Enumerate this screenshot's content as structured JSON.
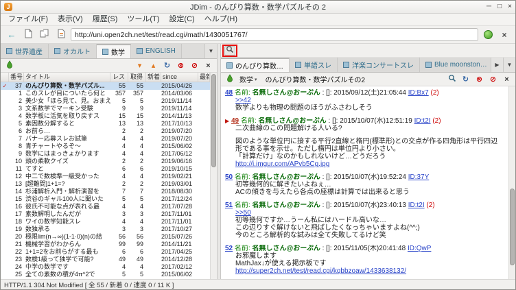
{
  "window": {
    "title": "JDim - のんびり算数・数学パズルその 2"
  },
  "menubar": {
    "items": [
      "ファイル(F)",
      "表示(V)",
      "履歴(S)",
      "ツール(T)",
      "設定(C)",
      "ヘルプ(H)"
    ]
  },
  "toolbar": {
    "url": "http://uni.open2ch.net/test/read.cgi/math/1430051767/"
  },
  "icons": {
    "back": "←",
    "window_minimize": "─",
    "window_maximize": "□",
    "window_close": "×",
    "tab_overflow": "▼",
    "tab_scroll_right": "▶",
    "check_down": "▾",
    "check_up": "▴",
    "refresh": "↻",
    "delete_circle": "⊗",
    "stop_circle": "⊘",
    "close_x": "×",
    "dropdown_arrow": "▾",
    "bookmark_check": "✓",
    "post_marker": "▶"
  },
  "board_pane": {
    "tabs": [
      {
        "label": "世界遺産",
        "active": false
      },
      {
        "label": "オカルト",
        "active": false
      },
      {
        "label": "数学",
        "active": true
      },
      {
        "label": "ENGLISH",
        "active": false
      }
    ],
    "columns": [
      "番号",
      "タイトル",
      "レス",
      "取得",
      "新着",
      "since",
      "最新書込"
    ],
    "rows": [
      {
        "no": "37",
        "title": "のんびり算数・数学パズル...",
        "res": "55",
        "got": "55",
        "new": "",
        "since": "2015/04/26",
        "last": "",
        "selected": true,
        "bookmark": true
      },
      {
        "no": "1",
        "title": "このスレが目についたら何と",
        "res": "357",
        "got": "357",
        "new": "",
        "since": "2014/03/06",
        "last": ""
      },
      {
        "no": "2",
        "title": "美少女「ほら見て、見。おまえ",
        "res": "5",
        "got": "5",
        "new": "",
        "since": "2019/11/14",
        "last": ""
      },
      {
        "no": "3",
        "title": "文系数学でマーキン受験",
        "res": "9",
        "got": "9",
        "new": "",
        "since": "2019/11/14",
        "last": ""
      },
      {
        "no": "4",
        "title": "数学板に活気を取り戻すス",
        "res": "15",
        "got": "15",
        "new": "",
        "since": "2014/11/13",
        "last": ""
      },
      {
        "no": "5",
        "title": "素因数分解すると",
        "res": "13",
        "got": "13",
        "new": "",
        "since": "2017/10/13",
        "last": ""
      },
      {
        "no": "6",
        "title": "お前ら…",
        "res": "2",
        "got": "2",
        "new": "",
        "since": "2019/07/20",
        "last": ""
      },
      {
        "no": "7",
        "title": "バナー応募スレお試筆",
        "res": "4",
        "got": "4",
        "new": "",
        "since": "2019/07/20",
        "last": ""
      },
      {
        "no": "8",
        "title": "青チャートやるぞ〜",
        "res": "4",
        "got": "4",
        "new": "",
        "since": "2015/06/02",
        "last": ""
      },
      {
        "no": "9",
        "title": "数学にはまっきょかります",
        "res": "4",
        "got": "4",
        "new": "",
        "since": "2017/06/12",
        "last": ""
      },
      {
        "no": "10",
        "title": "頭の柔軟クイズ",
        "res": "2",
        "got": "2",
        "new": "",
        "since": "2019/06/16",
        "last": ""
      },
      {
        "no": "11",
        "title": "てすと",
        "res": "6",
        "got": "6",
        "new": "",
        "since": "2019/10/15",
        "last": ""
      },
      {
        "no": "12",
        "title": "中二で数検準一級受かった",
        "res": "4",
        "got": "4",
        "new": "",
        "since": "2019/02/21",
        "last": ""
      },
      {
        "no": "13",
        "title": "[超難問]1+1=?",
        "res": "2",
        "got": "2",
        "new": "",
        "since": "2019/03/01",
        "last": ""
      },
      {
        "no": "14",
        "title": "杉浦解析入門・解析演習を",
        "res": "7",
        "got": "7",
        "new": "",
        "since": "2018/08/30",
        "last": ""
      },
      {
        "no": "15",
        "title": "渋谷のギャル100人に聞いた",
        "res": "5",
        "got": "5",
        "new": "",
        "since": "2017/12/24",
        "last": ""
      },
      {
        "no": "16",
        "title": "彼氏不可能な点が表れる最",
        "res": "4",
        "got": "4",
        "new": "",
        "since": "2017/07/28",
        "last": ""
      },
      {
        "no": "17",
        "title": "素数解明したんだが",
        "res": "3",
        "got": "3",
        "new": "",
        "since": "2017/11/01",
        "last": ""
      },
      {
        "no": "18",
        "title": "ワイの数学知能スレ",
        "res": "4",
        "got": "4",
        "new": "",
        "since": "2017/11/01",
        "last": ""
      },
      {
        "no": "19",
        "title": "数独承る",
        "res": "3",
        "got": "3",
        "new": "",
        "since": "2017/10/27",
        "last": ""
      },
      {
        "no": "20",
        "title": "極限lim(n→∞)(1-1·0)(n)の結",
        "res": "56",
        "got": "56",
        "new": "",
        "since": "2015/07/26",
        "last": ""
      },
      {
        "no": "21",
        "title": "機械学習がわからん",
        "res": "99",
        "got": "99",
        "new": "",
        "since": "2014/11/21",
        "last": ""
      },
      {
        "no": "22",
        "title": "1+1=2をお前らがする最も",
        "res": "6",
        "got": "6",
        "new": "",
        "since": "2017/04/25",
        "last": ""
      },
      {
        "no": "23",
        "title": "数検1級って独学で可能?",
        "res": "49",
        "got": "49",
        "new": "",
        "since": "2014/12/28",
        "last": ""
      },
      {
        "no": "24",
        "title": "中学の数学です",
        "res": "4",
        "got": "4",
        "new": "",
        "since": "2017/02/12",
        "last": ""
      },
      {
        "no": "25",
        "title": "全ての素数の積が4π^2で",
        "res": "5",
        "got": "5",
        "new": "",
        "since": "2015/06/02",
        "last": ""
      }
    ]
  },
  "thread_pane": {
    "tabs": [
      {
        "label": "のんびり算数…",
        "active": true
      },
      {
        "label": "単語スレ",
        "active": false
      },
      {
        "label": "洋楽コンサートスレ",
        "active": false
      },
      {
        "label": "Blue moonston…",
        "active": false
      }
    ],
    "board_label": "数学",
    "title": "のんびり算数・数学パズルその2",
    "name_label": "名前:",
    "mail_sep": ": []: ",
    "posts": [
      {
        "no": "48",
        "name": "名無しさん@おーぷん",
        "datetime": "2015/09/12(土)21:05:44",
        "id": "ID:Bx7",
        "count": "(2)",
        "marked": false,
        "lines": [
          {
            "type": "link",
            "text": ">>42"
          },
          {
            "type": "text",
            "text": "数学よりも物理の問題のほうがふさわしそう"
          }
        ]
      },
      {
        "no": "49",
        "name": "名無しさん@おーぷん",
        "datetime": "2015/10/07(水)12:51:19",
        "id": "ID:t2I",
        "count": "(2)",
        "marked": true,
        "lines": [
          {
            "type": "text",
            "text": "二次曲線のこの問題解ける人いる?"
          },
          {
            "type": "blank",
            "text": ""
          },
          {
            "type": "text",
            "text": "図のような単位円に接する平行2直線と楕円(標準形)との交点が作る四角形は平行四辺形である事を示せ。ただし楕円は単位円より小さい。"
          },
          {
            "type": "text",
            "text": "「計算だけ」なのかもしれないけど…どうだろう"
          },
          {
            "type": "link",
            "text": "http://i.imgur.com/APvb5Cg.jpg"
          }
        ]
      },
      {
        "no": "50",
        "name": "名無しさん@おーぷん",
        "datetime": "2015/10/07(水)19:52:24",
        "id": "ID:37Y",
        "count": "",
        "marked": false,
        "lines": [
          {
            "type": "text",
            "text": "初等幾何的に解きたいよねぇ…"
          },
          {
            "type": "text",
            "text": "ACの傾きを与えたら各点の座標は計算では出来ると思う"
          }
        ]
      },
      {
        "no": "51",
        "name": "名無しさん@おーぷん",
        "datetime": "2015/10/07(水)23:40:13",
        "id": "ID:t2I",
        "count": "(2)",
        "marked": false,
        "lines": [
          {
            "type": "link",
            "text": ">>50"
          },
          {
            "type": "text",
            "text": "初等幾何ですか…うーん私にはハードル高いな…"
          },
          {
            "type": "text",
            "text": "この辺りすぐ解けないと飛ばしたくなっちゃいますよね(^^;)"
          },
          {
            "type": "text",
            "text": "今のところ解析的な試みは全て失敗してるけど笑"
          }
        ]
      },
      {
        "no": "52",
        "name": "名無しさん@おーぷん",
        "datetime": "2015/11/05(木)20:41:48",
        "id": "ID:QwP",
        "count": "",
        "marked": false,
        "lines": [
          {
            "type": "text",
            "text": "お邪魔します"
          },
          {
            "type": "text",
            "text": "MathJax↓が使える掲示板です"
          },
          {
            "type": "link",
            "text": "http://super2ch.net/test/read.cgi/kqbbzoaw/1433638132/"
          }
        ]
      }
    ]
  },
  "statusbar": {
    "text": "HTTP/1.1 304 Not Modified [ 全 55 / 新着 0 / 速度 0 / 11 K ]"
  }
}
